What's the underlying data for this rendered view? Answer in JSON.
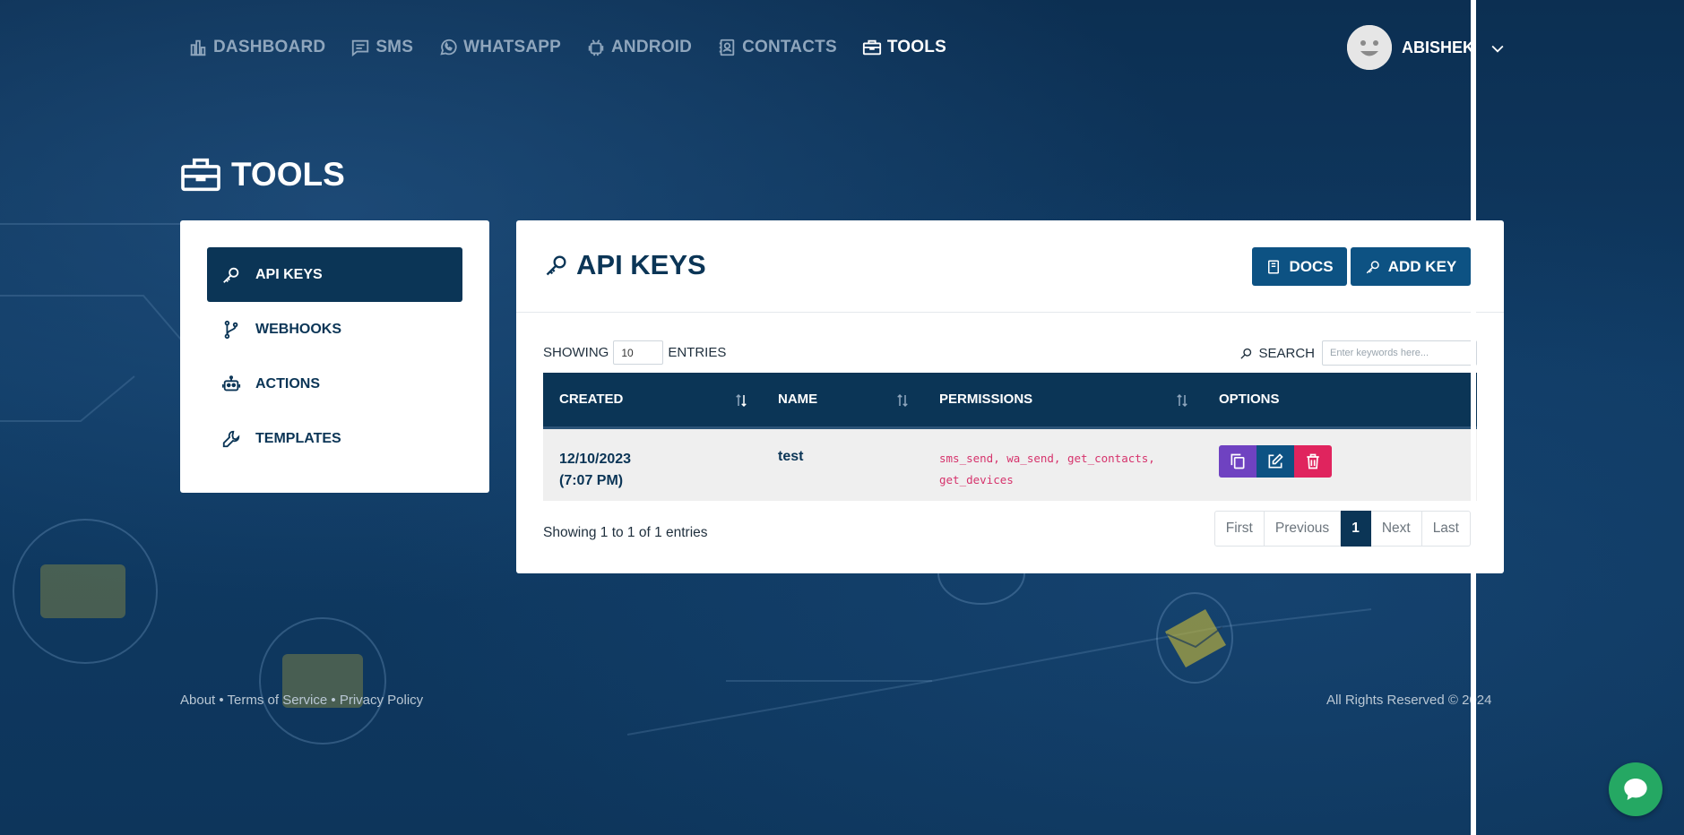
{
  "nav": {
    "items": [
      {
        "label": "DASHBOARD",
        "icon": "chart-bar-icon",
        "active": false
      },
      {
        "label": "SMS",
        "icon": "message-icon",
        "active": false
      },
      {
        "label": "WHATSAPP",
        "icon": "whatsapp-icon",
        "active": false
      },
      {
        "label": "ANDROID",
        "icon": "android-icon",
        "active": false
      },
      {
        "label": "CONTACTS",
        "icon": "contacts-icon",
        "active": false
      },
      {
        "label": "TOOLS",
        "icon": "toolbox-icon",
        "active": true
      }
    ]
  },
  "user": {
    "name": "ABISHEK"
  },
  "page": {
    "title": "TOOLS"
  },
  "sidebar": {
    "items": [
      {
        "label": "API KEYS",
        "icon": "key-icon",
        "active": true
      },
      {
        "label": "WEBHOOKS",
        "icon": "branch-icon",
        "active": false
      },
      {
        "label": "ACTIONS",
        "icon": "robot-icon",
        "active": false
      },
      {
        "label": "TEMPLATES",
        "icon": "wrench-icon",
        "active": false
      }
    ]
  },
  "card": {
    "title": "API KEYS",
    "docs_label": "DOCS",
    "add_label": "ADD KEY"
  },
  "controls": {
    "showing_label": "SHOWING",
    "entries_value": "10",
    "entries_label": "ENTRIES",
    "search_label": "SEARCH",
    "search_placeholder": "Enter keywords here..."
  },
  "table": {
    "headers": [
      "CREATED",
      "NAME",
      "PERMISSIONS",
      "OPTIONS"
    ],
    "rows": [
      {
        "created_date": "12/10/2023",
        "created_time": "(7:07 PM)",
        "name": "test",
        "perms_line1": "sms_send, wa_send, get_contacts,",
        "perms_line2": "get_devices"
      }
    ]
  },
  "pagination": {
    "info": "Showing 1 to 1 of 1 entries",
    "first": "First",
    "previous": "Previous",
    "current": "1",
    "next": "Next",
    "last": "Last"
  },
  "footer": {
    "about": "About",
    "terms": "Terms of Service",
    "privacy": "Privacy Policy",
    "separator": " • ",
    "copyright": "All Rights Reserved © 2024"
  },
  "colors": {
    "primary": "#0b3556",
    "button": "#0d5283",
    "copy": "#6f42c1",
    "delete": "#e0245e",
    "chat": "#25a863"
  }
}
